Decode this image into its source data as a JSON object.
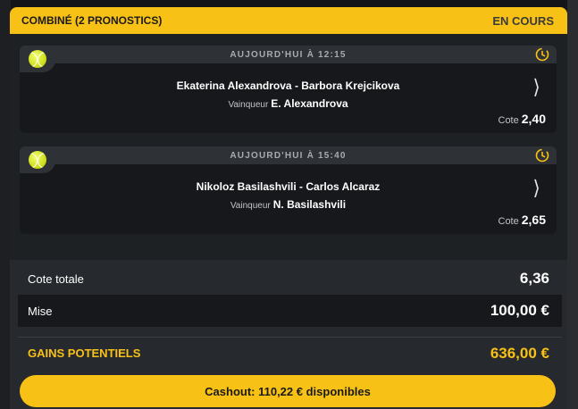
{
  "header": {
    "title": "COMBINÉ (2 PRONOSTICS)",
    "status": "EN COURS"
  },
  "colors": {
    "accent": "#f8c116",
    "background": "#121417",
    "card": "#26292d",
    "bet_bg": "#16181b"
  },
  "bets": [
    {
      "time": "AUJOURD'HUI À 12:15",
      "match": "Ekaterina Alexandrova - Barbora Krejcikova",
      "winner_label": "Vainqueur",
      "winner": "E. Alexandrova",
      "odds_label": "Cote",
      "odds": "2,40",
      "sport_icon": "tennis-ball-icon",
      "live_icon": "live-clock-icon"
    },
    {
      "time": "AUJOURD'HUI À 15:40",
      "match": "Nikoloz Basilashvili - Carlos Alcaraz",
      "winner_label": "Vainqueur",
      "winner": "N. Basilashvili",
      "odds_label": "Cote",
      "odds": "2,65",
      "sport_icon": "tennis-ball-icon",
      "live_icon": "live-clock-icon"
    }
  ],
  "summary": {
    "total_odds_label": "Cote totale",
    "total_odds": "6,36",
    "stake_label": "Mise",
    "stake": "100,00 €",
    "gains_label": "GAINS POTENTIELS",
    "gains": "636,00 €"
  },
  "cashout": {
    "label": "Cashout: 110,22 € disponibles"
  }
}
